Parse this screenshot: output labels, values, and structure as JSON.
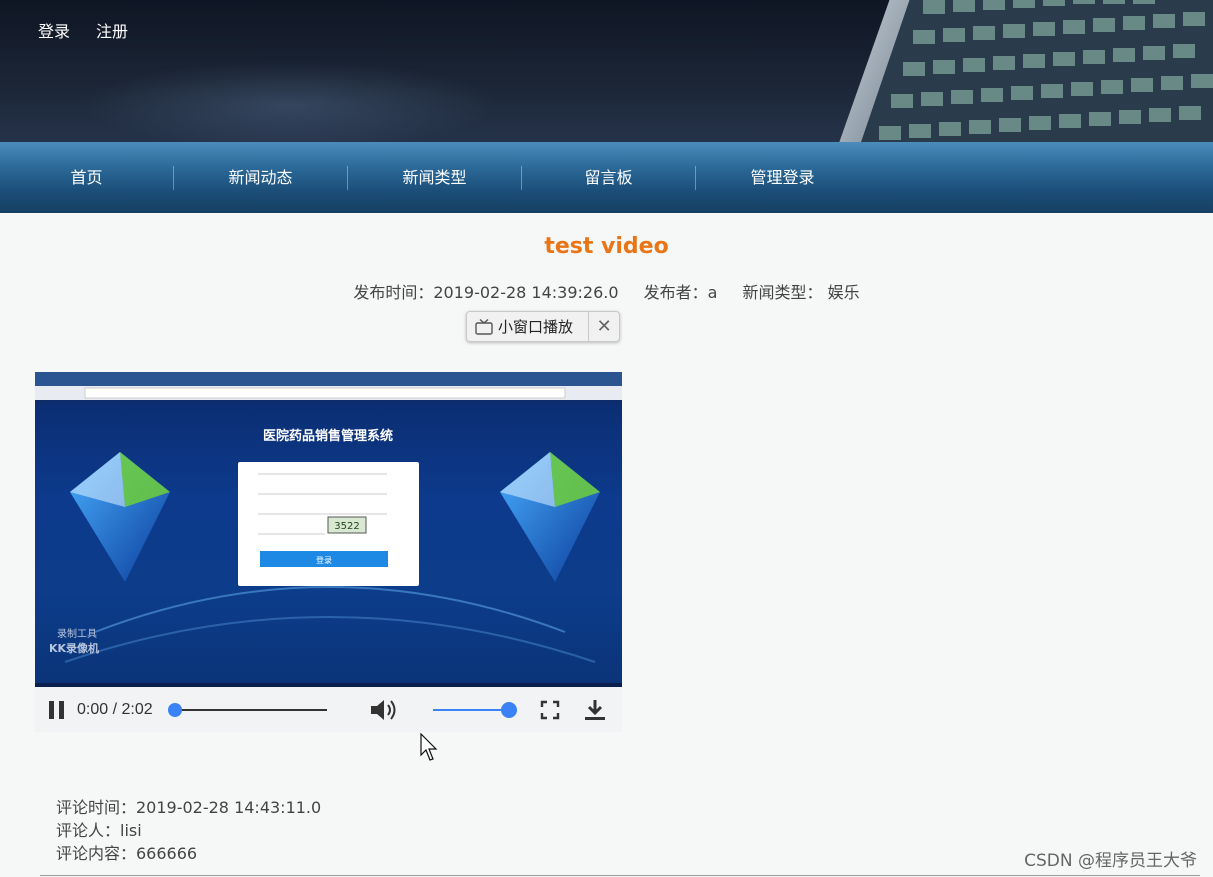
{
  "auth": {
    "login": "登录",
    "register": "注册"
  },
  "nav": {
    "items": [
      "首页",
      "新闻动态",
      "新闻类型",
      "留言板",
      "管理登录"
    ]
  },
  "article": {
    "title": "test video",
    "publish_time": "发布时间：2019-02-28 14:39:26.0",
    "publisher": "发布者：a",
    "news_type": "新闻类型： 娱乐"
  },
  "pip": {
    "label": "小窗口播放",
    "icon": "tv-icon",
    "close_icon": "close-icon"
  },
  "video": {
    "frame_title": "医院药品销售管理系统",
    "captcha": "3522",
    "login_button": "登录",
    "watermark_line1": "录制工具",
    "watermark_line2": "KK录像机"
  },
  "player": {
    "time": "0:00 / 2:02",
    "progress": 0,
    "volume": 1,
    "icons": [
      "pause-icon",
      "volume-icon",
      "fullscreen-icon",
      "download-icon"
    ]
  },
  "comment": {
    "time": "评论时间：2019-02-28 14:43:11.0",
    "author": "评论人：lisi",
    "content": "评论内容：666666"
  },
  "watermark": "CSDN @程序员王大爷",
  "colors": {
    "title": "#e87617",
    "nav": "#1b4e78",
    "accent": "#3b82f6"
  }
}
